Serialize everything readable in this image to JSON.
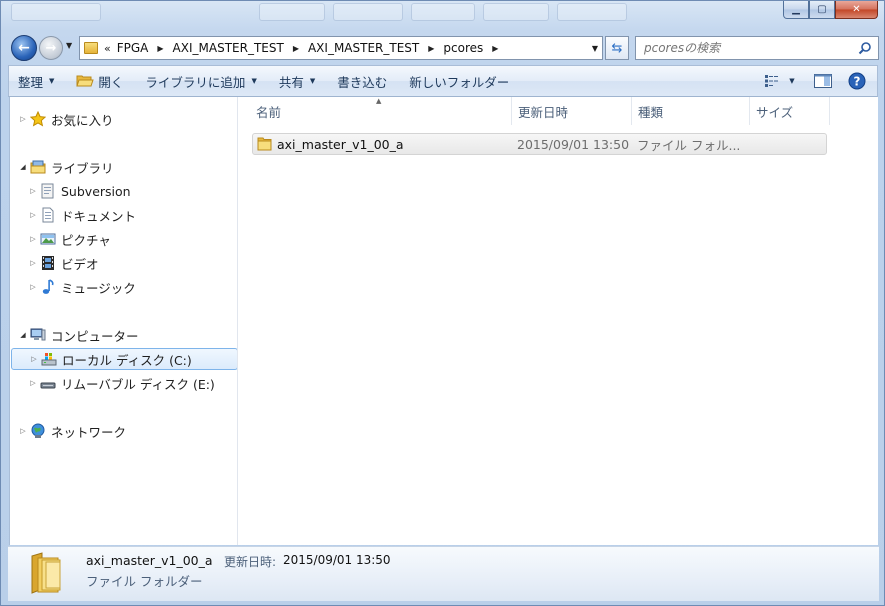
{
  "window": {
    "minimize_glyph": "▁",
    "maximize_glyph": "▢",
    "close_glyph": "✕"
  },
  "address": {
    "chevron": "«",
    "crumbs": [
      "FPGA",
      "AXI_MASTER_TEST",
      "AXI_MASTER_TEST",
      "pcores"
    ]
  },
  "search": {
    "placeholder": "pcoresの検索"
  },
  "toolbar": {
    "organize": "整理",
    "open": "開く",
    "include_library": "ライブラリに追加",
    "share": "共有",
    "burn": "書き込む",
    "new_folder": "新しいフォルダー"
  },
  "nav": {
    "favorites": "お気に入り",
    "libraries": "ライブラリ",
    "subversion": "Subversion",
    "documents": "ドキュメント",
    "pictures": "ピクチャ",
    "videos": "ビデオ",
    "music": "ミュージック",
    "computer": "コンピューター",
    "local_disk": "ローカル ディスク (C:)",
    "removable_disk": "リムーバブル ディスク (E:)",
    "network": "ネットワーク"
  },
  "columns": {
    "name": "名前",
    "modified": "更新日時",
    "type": "種類",
    "size": "サイズ"
  },
  "files": [
    {
      "name": "axi_master_v1_00_a",
      "modified": "2015/09/01 13:50",
      "type": "ファイル フォル..."
    }
  ],
  "details": {
    "name": "axi_master_v1_00_a",
    "modified_label": "更新日時:",
    "modified_value": "2015/09/01 13:50",
    "type": "ファイル フォルダー"
  },
  "colors": {
    "accent": "#2a63b8",
    "selection_border": "#7eb4ea",
    "toolbar_text": "#1e395b"
  }
}
